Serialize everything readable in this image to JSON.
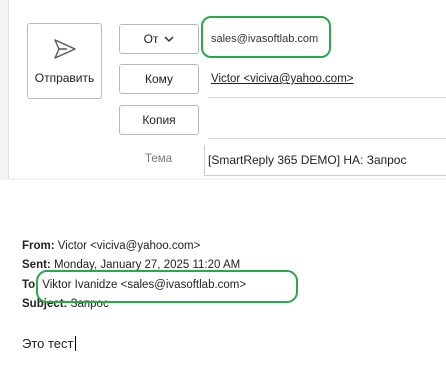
{
  "compose": {
    "send_label": "Отправить",
    "from_button_label": "От",
    "from_value": "sales@ivasoftlab.com",
    "to_button_label": "Кому",
    "to_value": "Victor <viciva@yahoo.com>",
    "cc_button_label": "Копия",
    "subject_label": "Тема",
    "subject_value": "[SmartReply 365 DEMO] НА: Запрос"
  },
  "quoted": {
    "from_label": "From:",
    "from_value": "Victor <viciva@yahoo.com>",
    "sent_label": "Sent:",
    "sent_value": "Monday, January 27, 2025 11:20 AM",
    "to_label": "To:",
    "to_value": "Viktor Ivanidze <sales@ivasoftlab.com>",
    "subject_label": "Subject:",
    "subject_value": "Запрос"
  },
  "body_text": "Это тест",
  "colors": {
    "highlight": "#2aa84a",
    "border": "#b9b9b9"
  }
}
